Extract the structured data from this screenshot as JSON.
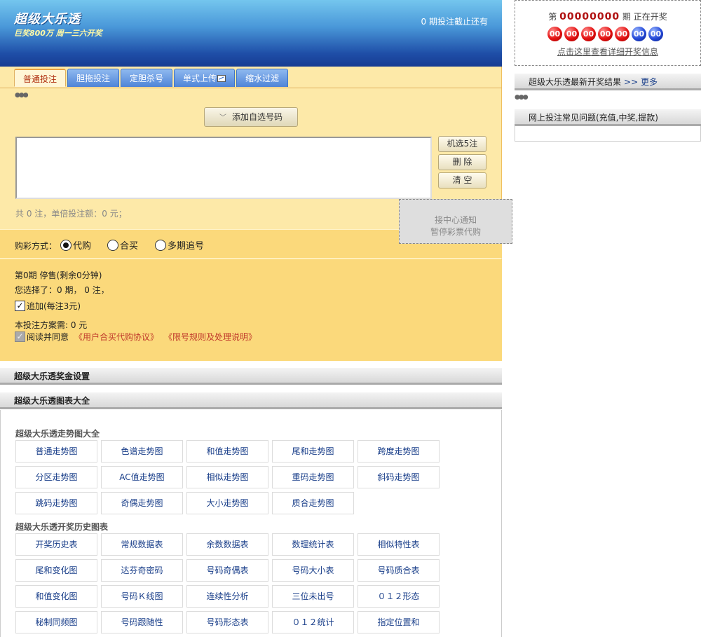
{
  "header": {
    "title": "超级大乐透",
    "subtitle": "巨奖800万 周一三六开奖",
    "deadline": "0 期投注截止还有"
  },
  "tabs": [
    {
      "label": "普通投注"
    },
    {
      "label": "胆拖投注"
    },
    {
      "label": "定胆杀号"
    },
    {
      "label": "单式上传"
    },
    {
      "label": "缩水过滤"
    }
  ],
  "bet": {
    "add_button": "添加自选号码",
    "random_button": "机选5注",
    "delete_button": "删  除",
    "clear_button": "清  空",
    "summary": "共 0 注，单倍投注额：0 元；"
  },
  "purchase": {
    "label": "购彩方式：",
    "options": [
      "代购",
      "合买",
      "多期追号"
    ],
    "selected": "代购"
  },
  "info": {
    "issue_status": "第0期 停售(剩余0分钟)",
    "selection": "您选择了：0 期， 0 注，",
    "append_label": "追加(每注3元)",
    "plan_cost": "本投注方案需: 0 元",
    "agree_label": "阅读并同意",
    "agreement_link": "《用户合买代购协议》",
    "rules_link": "《限号规则及处理说明》"
  },
  "notice": {
    "line1": "接中心通知",
    "line2": "暂停彩票代购"
  },
  "sections": {
    "prize_settings": "超级大乐透奖金设置",
    "charts": "超级大乐透图表大全"
  },
  "trend_group": {
    "title": "超级大乐透走势图大全",
    "items": [
      "普通走势图",
      "色谱走势图",
      "和值走势图",
      "尾和走势图",
      "跨度走势图",
      "分区走势图",
      "AC值走势图",
      "相似走势图",
      "重码走势图",
      "斜码走势图",
      "跳码走势图",
      "奇偶走势图",
      "大小走势图",
      "质合走势图"
    ]
  },
  "history_group": {
    "title": "超级大乐透开奖历史图表",
    "items": [
      "开奖历史表",
      "常规数据表",
      "余数数据表",
      "数理统计表",
      "相似特性表",
      "尾和变化图",
      "达芬奇密码",
      "号码奇偶表",
      "号码大小表",
      "号码质合表",
      "和值变化图",
      "号码Ｋ线图",
      "连续性分析",
      "三位未出号",
      "０１２形态",
      "秘制同频图",
      "号码跟随性",
      "号码形态表",
      "０１２统计",
      "指定位置和"
    ]
  },
  "draw": {
    "prefix": "第",
    "issue": "00000000",
    "suffix": "期  正在开奖",
    "balls": [
      {
        "num": "00",
        "color": "red"
      },
      {
        "num": "00",
        "color": "red"
      },
      {
        "num": "00",
        "color": "red"
      },
      {
        "num": "00",
        "color": "red"
      },
      {
        "num": "00",
        "color": "red"
      },
      {
        "num": "00",
        "color": "blue"
      },
      {
        "num": "00",
        "color": "blue"
      }
    ],
    "detail_link": "点击这里查看详细开奖信息"
  },
  "sidebar": {
    "latest_title": "超级大乐透最新开奖结果",
    "more_link": ">> 更多",
    "faq_title": "网上投注常见问题(充值,中奖,提款)"
  }
}
